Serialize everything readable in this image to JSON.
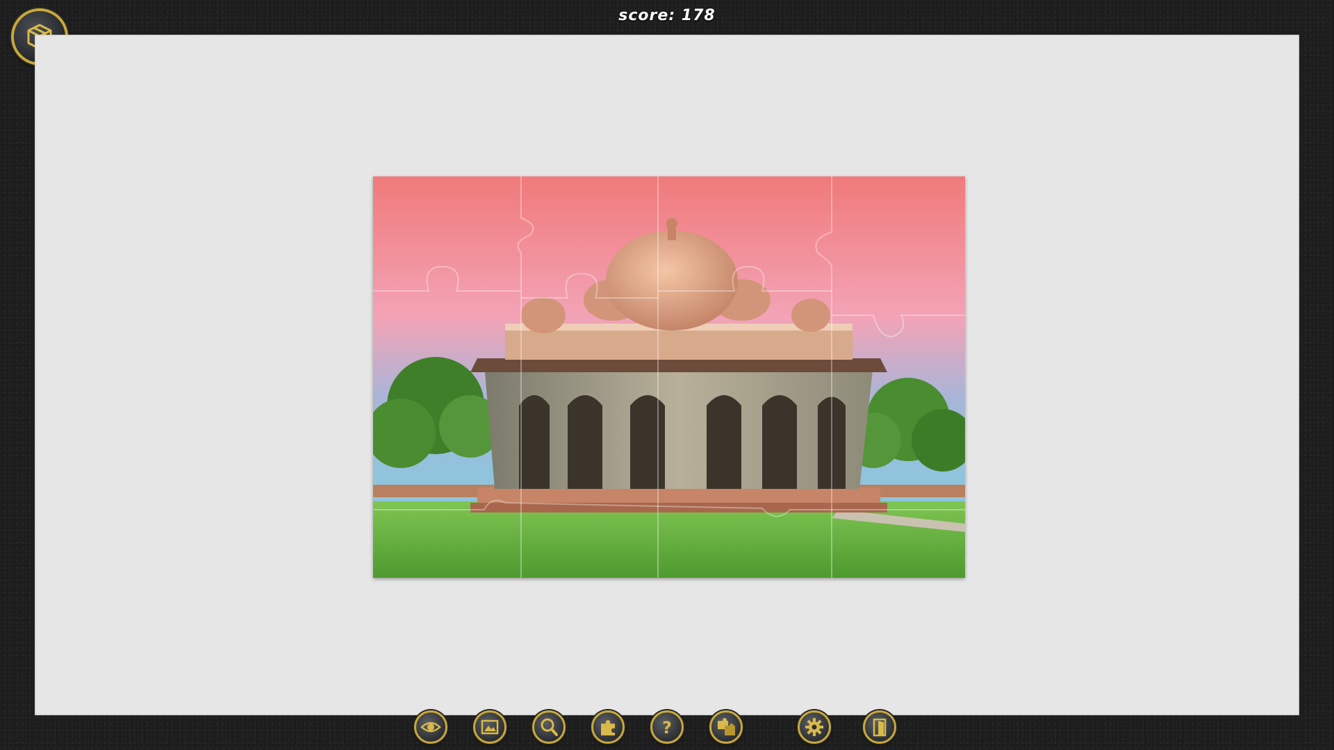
{
  "hud": {
    "score_text": "score: 178"
  },
  "menu_button": {
    "icon": "box-icon"
  },
  "puzzle": {
    "image_subject": "",
    "pieces_grid": {
      "columns": 4,
      "rows": 3
    }
  },
  "toolbar": {
    "buttons": [
      {
        "name": "preview-button",
        "icon": "eye-icon"
      },
      {
        "name": "background-button",
        "icon": "picture-icon"
      },
      {
        "name": "zoom-button",
        "icon": "magnifier-icon"
      },
      {
        "name": "edge-pieces-button",
        "icon": "puzzle-piece-icon"
      },
      {
        "name": "hint-button",
        "icon": "question-icon"
      },
      {
        "name": "sort-pieces-button",
        "icon": "puzzle-pieces-icon"
      },
      {
        "name": "settings-button",
        "icon": "gear-icon"
      },
      {
        "name": "exit-button",
        "icon": "door-icon"
      }
    ]
  },
  "colors": {
    "accent_gold": "#c9a83b",
    "board_bg": "#e7e7e7",
    "frame_bg": "#1d1d1d"
  }
}
